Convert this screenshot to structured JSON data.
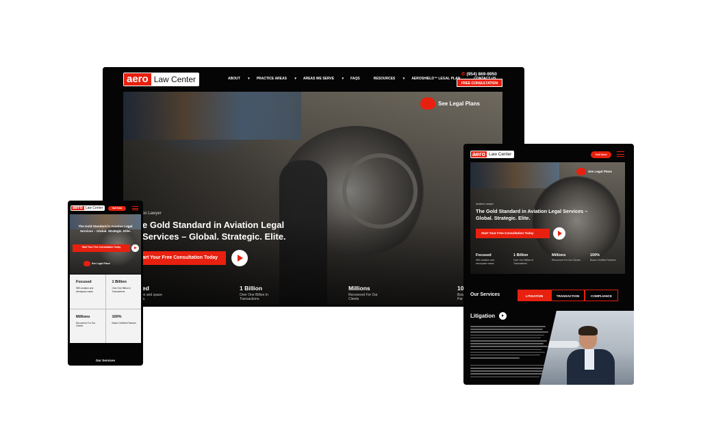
{
  "desktop": {
    "logo": {
      "brand": "aero",
      "name": "Law Center",
      "reg": "®"
    },
    "menu": [
      {
        "label": "ABOUT",
        "dropdown": true
      },
      {
        "label": "PRACTICE AREAS",
        "dropdown": true
      },
      {
        "label": "AREAS WE SERVE",
        "dropdown": true
      },
      {
        "label": "FAQS",
        "dropdown": false
      },
      {
        "label": "RESOURCES",
        "dropdown": true
      },
      {
        "label": "AEROSHIELD™ LEGAL PLAN",
        "dropdown": false
      },
      {
        "label": "CONTACT US",
        "dropdown": false
      }
    ],
    "phone": "(954) 869-8950",
    "cta": "FREE CONSULTATION",
    "see_plans": "See Legal Plans",
    "eyebrow": "on Lawyer",
    "title": "e Gold Standard in Aviation Legal Services – Global. Strategic. Elite.",
    "button": "tart Your Free Consultation Today",
    "stats": [
      {
        "value": "used",
        "desc": "viation and space cases."
      },
      {
        "value": "1 Billion",
        "desc": "Over One Billion In Transactions"
      },
      {
        "value": "Millions",
        "desc": "Recovered For Our Clients"
      },
      {
        "value": "10",
        "desc": "Boa Par"
      }
    ]
  },
  "mobile": {
    "logo": {
      "brand": "aero",
      "name": "Law Center"
    },
    "call": "Call Now",
    "title": "The Gold Standard in Aviation Legal Services – Global. Strategic. Elite.",
    "button": "Start Your Free Consultation Today",
    "see_plans": "See Legal Plans",
    "stats": [
      {
        "value": "Focused",
        "desc": "98% aviation and aerospace cases."
      },
      {
        "value": "1 Billion",
        "desc": "Over One Billion In Transactions"
      },
      {
        "value": "Millions",
        "desc": "Recovered For Our Clients"
      },
      {
        "value": "100%",
        "desc": "Board Certified Partners"
      }
    ],
    "services_heading": "Our Services"
  },
  "tablet": {
    "logo": {
      "brand": "aero",
      "name": "Law Center"
    },
    "call": "Call Now",
    "see_plans": "See Legal Plans",
    "eyebrow": "Aviation Lawyer",
    "title": "The Gold Standard in Aviation Legal Services – Global. Strategic. Elite.",
    "button": "Start Your Free Consultation Today",
    "stats": [
      {
        "value": "Focused",
        "desc": "98% aviation and aerospace cases."
      },
      {
        "value": "1 Billion",
        "desc": "Over One Billion In Transactions"
      },
      {
        "value": "Millions",
        "desc": "Recovered For Our Clients"
      },
      {
        "value": "100%",
        "desc": "Board Certified Partners"
      }
    ],
    "services_heading": "Our Services",
    "tabs": [
      "LITIGATION",
      "TRANSACTION",
      "COMPLIANCE"
    ],
    "active_tab": "LITIGATION",
    "section_title": "Litigation"
  },
  "colors": {
    "accent": "#e8200f",
    "background": "#050505",
    "page": "#ffffff"
  }
}
